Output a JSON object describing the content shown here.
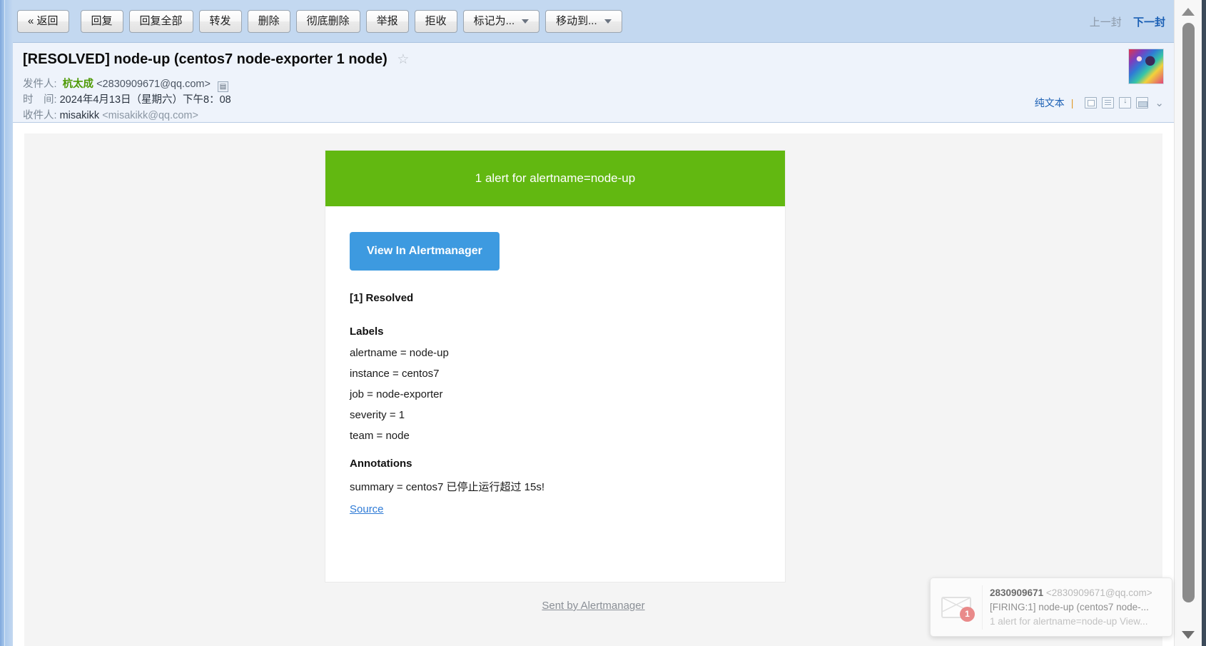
{
  "toolbar": {
    "buttons": [
      {
        "label": "« 返回",
        "caret": false
      },
      {
        "label": "回复",
        "caret": false
      },
      {
        "label": "回复全部",
        "caret": false
      },
      {
        "label": "转发",
        "caret": false
      },
      {
        "label": "删除",
        "caret": false
      },
      {
        "label": "彻底删除",
        "caret": false
      },
      {
        "label": "举报",
        "caret": false
      },
      {
        "label": "拒收",
        "caret": false
      },
      {
        "label": "标记为...",
        "caret": true
      },
      {
        "label": "移动到...",
        "caret": true
      }
    ],
    "prev_label": "上一封",
    "next_label": "下一封"
  },
  "mail_header": {
    "subject": "[RESOLVED] node-up (centos7 node-exporter 1 node)",
    "star": "☆",
    "from_label": "发件人:",
    "from_name": "杭太成",
    "from_address": "<2830909671@qq.com>",
    "time_label": "时　间:",
    "time_value": "2024年4月13日（星期六）下午8：08",
    "to_label": "收件人:",
    "to_name": "misakikk",
    "to_address": "<misakikk@qq.com>",
    "plain_text_link": "纯文本",
    "divider": "|",
    "chevron": "⌄"
  },
  "mail_body": {
    "banner_text": "1 alert for alertname=node-up",
    "banner_color": "#62b811",
    "view_button_label": "View In Alertmanager",
    "view_button_color": "#3d9ae0",
    "status_heading": "[1] Resolved",
    "labels_heading": "Labels",
    "labels": [
      "alertname = node-up",
      "instance = centos7",
      "job = node-exporter",
      "severity = 1",
      "team = node"
    ],
    "annotations_heading": "Annotations",
    "annotations": [
      "summary = centos7 已停止运行超过 15s!"
    ],
    "source_link": "Source",
    "footer_link": "Sent by Alertmanager"
  },
  "toast": {
    "badge_count": "1",
    "sender": "2830909671",
    "sender_address": "<2830909671@qq.com>",
    "subject": "[FIRING:1] node-up (centos7 node-...",
    "preview": "1 alert for alertname=node-up View..."
  }
}
